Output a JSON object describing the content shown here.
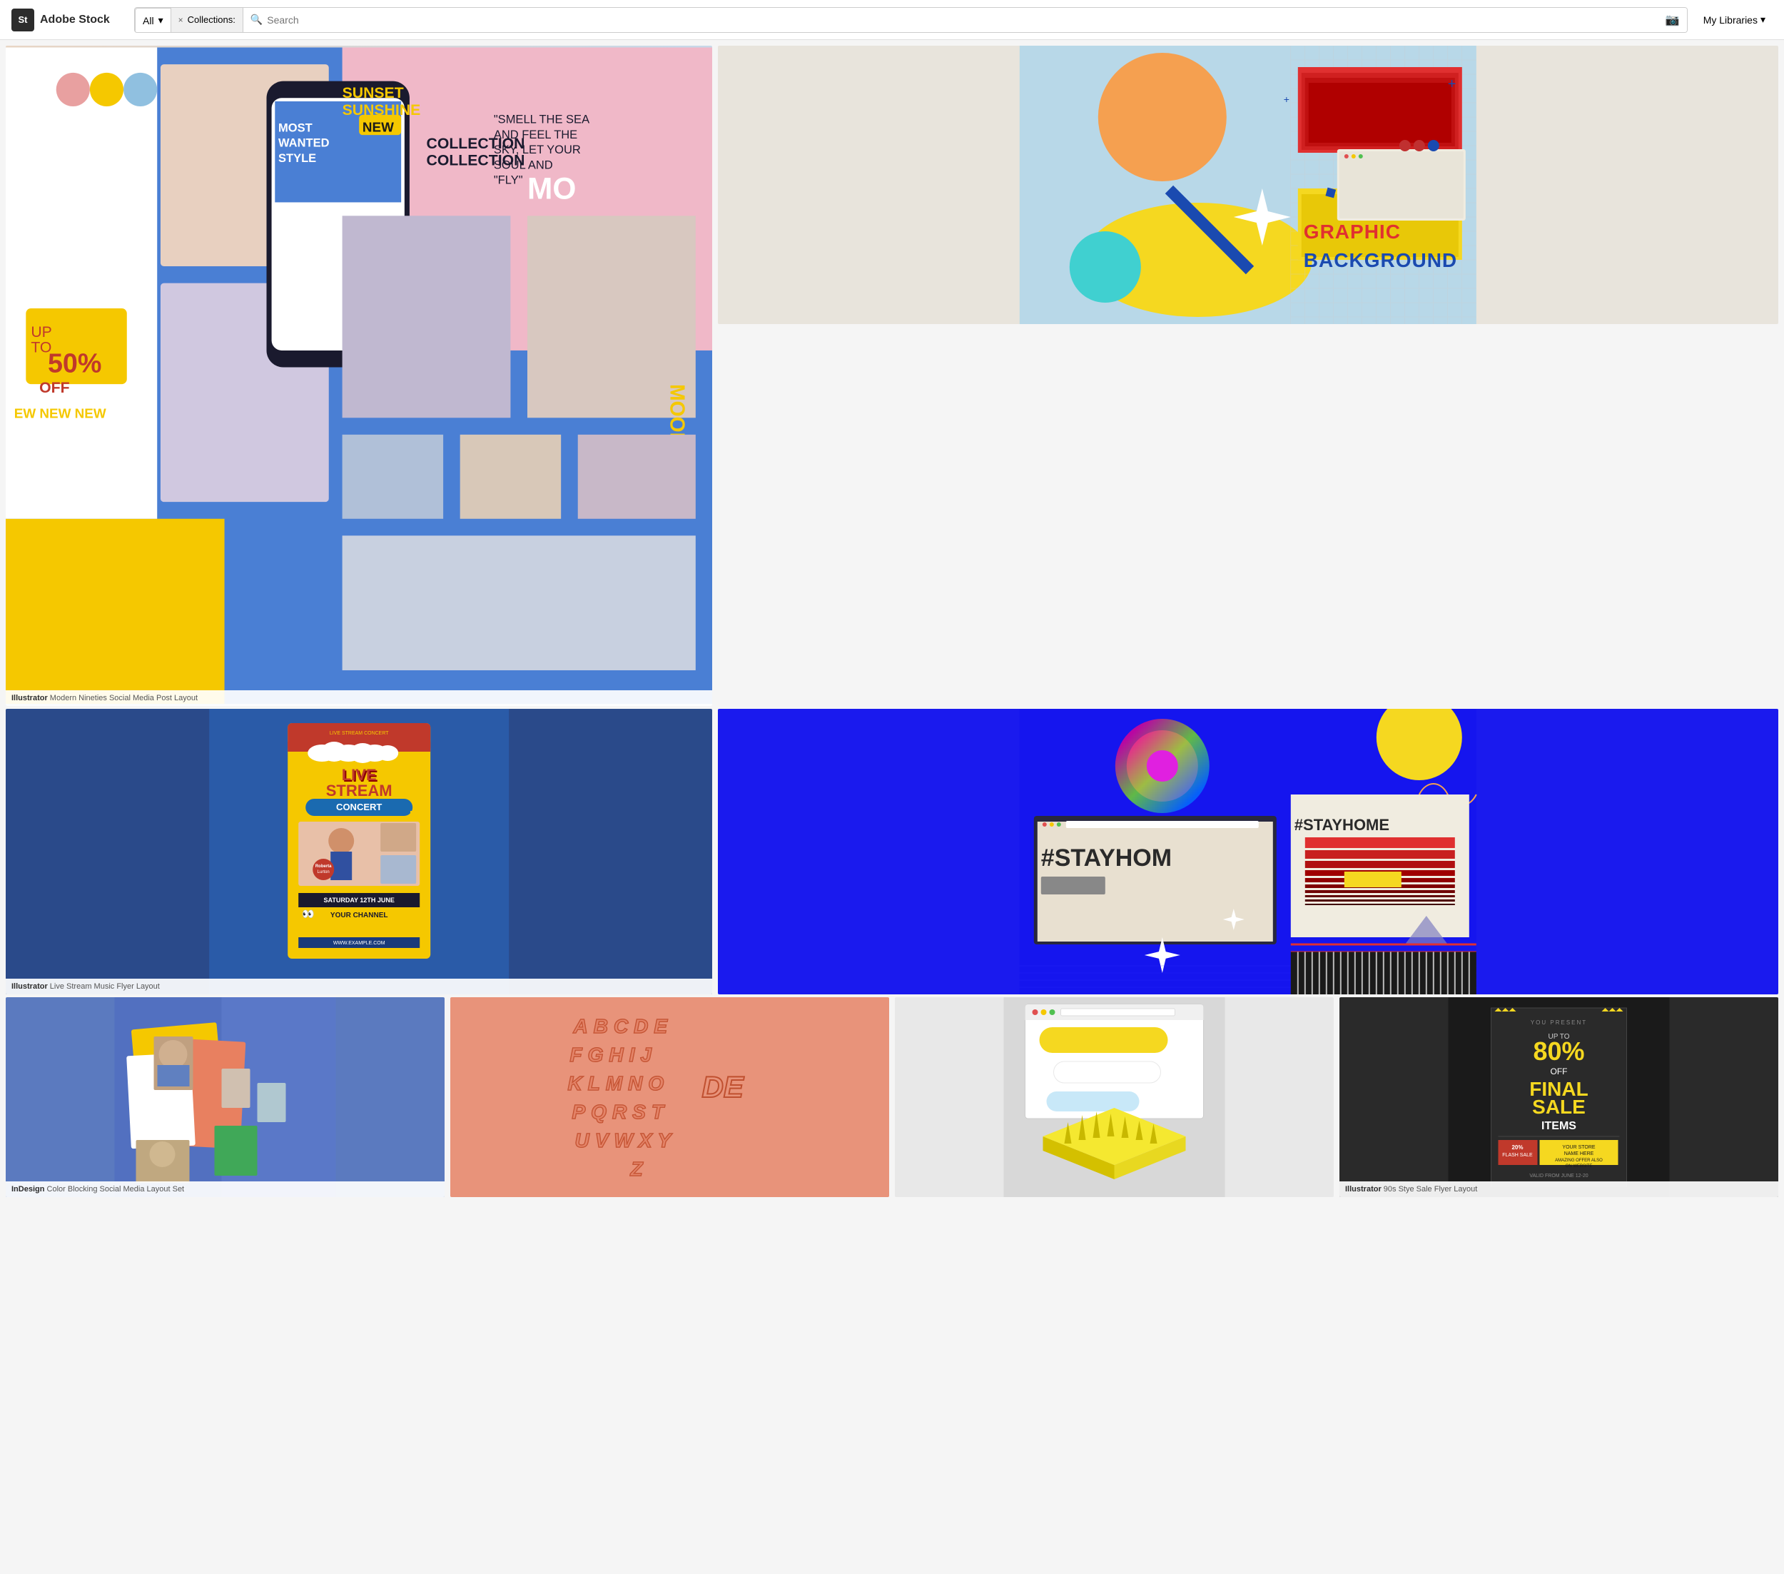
{
  "header": {
    "logo_letters": "St",
    "logo_name": "Adobe Stock",
    "filter_label": "All",
    "filter_arrow": "▾",
    "collections_label": "Collections:",
    "collections_x": "×",
    "search_placeholder": "Search",
    "camera_icon_label": "📷",
    "my_libraries_label": "My Libraries",
    "my_libraries_arrow": "▾"
  },
  "tiles": [
    {
      "id": "social-media",
      "app": "Illustrator",
      "desc": "Modern Nineties Social Media Post Layout",
      "position": "row1-left"
    },
    {
      "id": "graphic-bg",
      "app": "",
      "desc": "",
      "position": "row1-right"
    },
    {
      "id": "livestream",
      "app": "Illustrator",
      "desc": "Live Stream Music Flyer Layout",
      "position": "row2-left"
    },
    {
      "id": "stayhome",
      "app": "",
      "desc": "",
      "position": "row2-right"
    },
    {
      "id": "colorblock",
      "app": "InDesign",
      "desc": "Color Blocking Social Media Layout Set",
      "position": "row3-1"
    },
    {
      "id": "alphabet",
      "app": "",
      "desc": "",
      "position": "row3-2"
    },
    {
      "id": "threed",
      "app": "",
      "desc": "",
      "position": "row3-3"
    },
    {
      "id": "sale",
      "app": "Illustrator",
      "desc": "90s Stye Sale Flyer Layout",
      "position": "row3-4"
    }
  ],
  "flyer": {
    "live": "LIVE",
    "stream": "STREAM",
    "concert": "CONCERT",
    "cursor": "🖱",
    "date": "SATURDAY 12TH JUNE",
    "your_channel": "YOUR CHANNEL",
    "url": "WWW.EXAMPLE.COM"
  },
  "sale": {
    "present": "YOU PRESENT",
    "up_to": "UP TO",
    "percent": "80%",
    "off": "OFF",
    "final": "FINAL",
    "sale": "SALE",
    "items": "ITEMS",
    "badge1": "20% FLASH SALE",
    "badge2": "YOUR STORE NAME HERE",
    "badge3": "AMAZING OFFER ALSO ON WEBSITE",
    "valid": "VALID FROM JUNE 12-20"
  },
  "stayhome": {
    "text": "#STAYHOME"
  },
  "graphic": {
    "text": "GRAPHIC BACKGROUND"
  },
  "alphabet_letters": "ABCDE\nFGHIJ\nKLMNO\nPQRST\nUVWXY\nZ",
  "colors": {
    "accent_red": "#c0392b",
    "accent_yellow": "#f5c800",
    "accent_blue": "#1515ee",
    "nav_bg": "#ffffff",
    "body_bg": "#f5f5f5"
  }
}
